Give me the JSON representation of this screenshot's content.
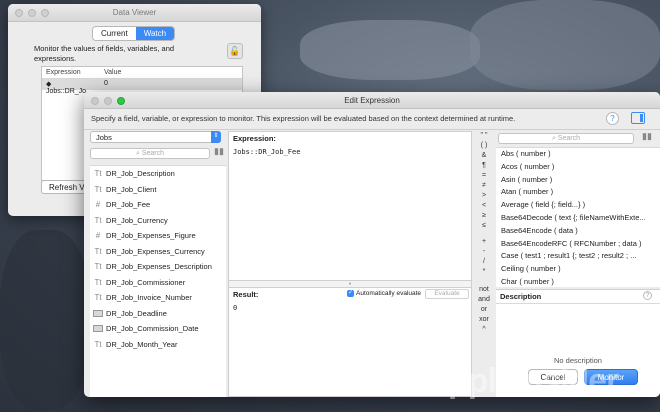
{
  "data_viewer": {
    "title": "Data Viewer",
    "tabs": [
      "Current",
      "Watch"
    ],
    "active_tab": "Watch",
    "description": "Monitor the values of fields, variables, and expressions.",
    "columns": [
      "Expression",
      "Value"
    ],
    "rows": [
      {
        "expression": "Jobs::DR_Jo...",
        "value": "0"
      }
    ],
    "refresh_label": "Refresh Va"
  },
  "edit_expression": {
    "title": "Edit Expression",
    "instructions": "Specify a field, variable, or expression to monitor. This expression will be evaluated based on the context determined at runtime.",
    "table_select": "Jobs",
    "search_placeholder": "Search",
    "fields": [
      {
        "icon": "text-field-icon",
        "glyph": "Tt",
        "name": "DR_Job_Description"
      },
      {
        "icon": "text-field-icon",
        "glyph": "Tt",
        "name": "DR_Job_Client"
      },
      {
        "icon": "number-field-icon",
        "glyph": "#",
        "name": "DR_Job_Fee"
      },
      {
        "icon": "text-field-icon",
        "glyph": "Tt",
        "name": "DR_Job_Currency"
      },
      {
        "icon": "number-field-icon",
        "glyph": "#",
        "name": "DR_Job_Expenses_Figure"
      },
      {
        "icon": "text-field-icon",
        "glyph": "Tt",
        "name": "DR_Job_Expenses_Currency"
      },
      {
        "icon": "text-field-icon",
        "glyph": "Tt",
        "name": "DR_Job_Expenses_Description"
      },
      {
        "icon": "text-field-icon",
        "glyph": "Tt",
        "name": "DR_Job_Commissioner"
      },
      {
        "icon": "text-field-icon",
        "glyph": "Tt",
        "name": "DR_Job_Invoice_Number"
      },
      {
        "icon": "date-field-icon",
        "glyph": "",
        "name": "DR_Job_Deadline"
      },
      {
        "icon": "date-field-icon",
        "glyph": "",
        "name": "DR_Job_Commission_Date"
      },
      {
        "icon": "text-field-icon",
        "glyph": "Tt",
        "name": "DR_Job_Month_Year"
      }
    ],
    "expression_label": "Expression:",
    "expression_value": "Jobs::DR_Job_Fee",
    "result_label": "Result:",
    "auto_evaluate_label": "Automatically evaluate",
    "evaluate_label": "Evaluate",
    "result_value": "0",
    "operators": [
      "\" \"",
      "( )",
      "&",
      "¶",
      "=",
      "≠",
      ">",
      "<",
      "≥",
      "≤",
      "+",
      "-",
      "/",
      "*",
      "not",
      "and",
      "or",
      "xor",
      "^"
    ],
    "functions": [
      "Abs ( number )",
      "Acos ( number )",
      "Asin ( number )",
      "Atan ( number )",
      "Average ( field {; field...} )",
      "Base64Decode ( text {; fileNameWithExte...",
      "Base64Encode ( data )",
      "Base64EncodeRFC ( RFCNumber ; data )",
      "Case ( test1 ; result1 {; test2 ; result2 ; ...",
      "Ceiling ( number )",
      "Char ( number )"
    ],
    "description_label": "Description",
    "no_description": "No description",
    "cancel_label": "Cancel",
    "monitor_label": "Monitor"
  },
  "watermark": "appleinsider"
}
